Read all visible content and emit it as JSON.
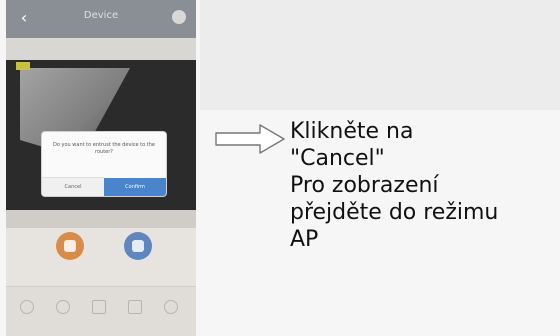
{
  "screen": {
    "nav": {
      "title": "Device"
    },
    "dialog": {
      "message": "Do you want to entrust the device to the router?",
      "cancel_label": "Cancel",
      "confirm_label": "Confirm"
    }
  },
  "instructions": {
    "line1": "Klikněte na",
    "line2": "\"Cancel\"",
    "line3": "Pro zobrazení",
    "line4": "přejděte do režimu",
    "line5": "AP"
  },
  "colors": {
    "nav_bar": "#8a8f96",
    "confirm_button": "#4a84cc",
    "record_button": "#d98c4a",
    "snapshot_button": "#5f86bf"
  },
  "icons": [
    "back-arrow-icon",
    "gear-icon",
    "record-icon",
    "camera-icon",
    "arrow-right-icon"
  ]
}
